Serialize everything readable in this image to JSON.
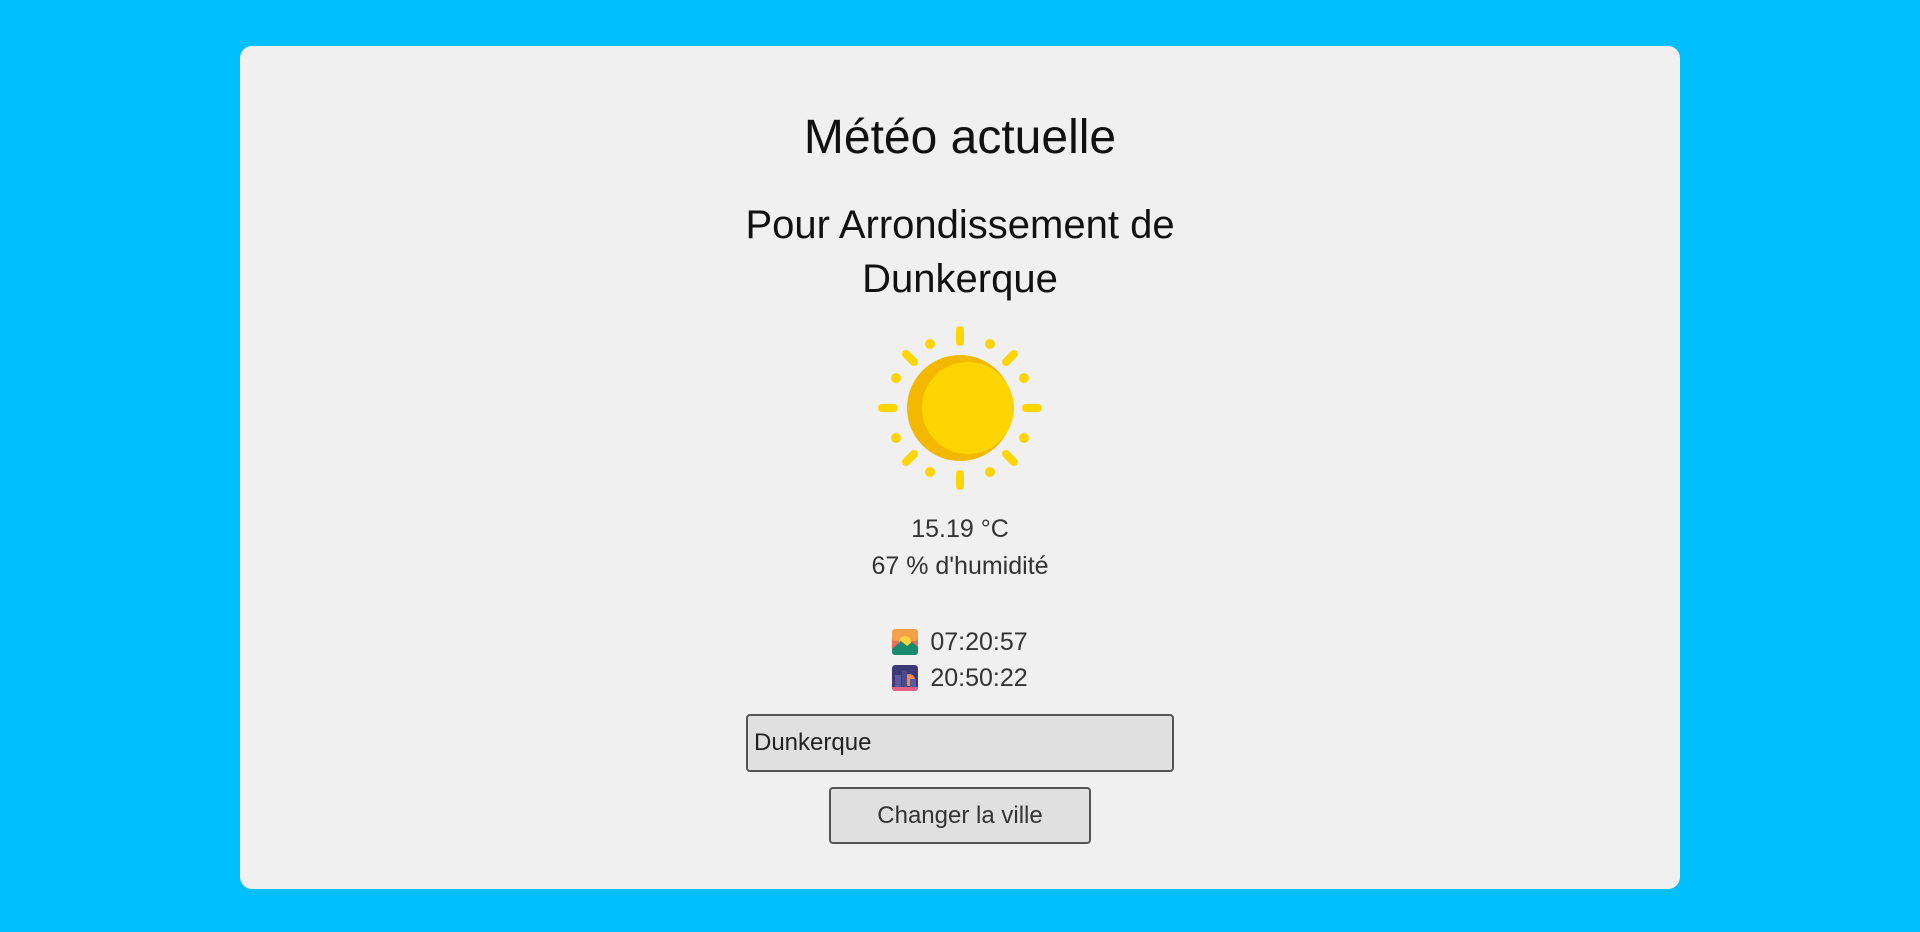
{
  "header": {
    "title": "Météo actuelle",
    "location": "Pour Arrondissement de Dunkerque"
  },
  "weather": {
    "icon": "sun-icon",
    "temperature": "15.19 °C",
    "humidity": "67 % d'humidité"
  },
  "sun": {
    "sunrise_icon": "sunrise-icon",
    "sunrise": "07:20:57",
    "sunset_icon": "sunset-icon",
    "sunset": "20:50:22"
  },
  "search": {
    "value": "Dunkerque",
    "button_label": "Changer la ville"
  },
  "colors": {
    "background": "#00bfff",
    "card": "#f0f0f0",
    "sun": "#ffd500",
    "sun_shade": "#f5b800"
  }
}
